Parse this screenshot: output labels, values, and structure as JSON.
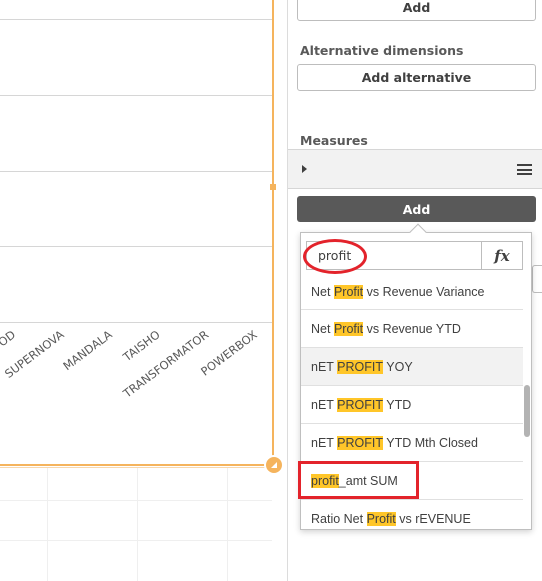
{
  "panel": {
    "add_dimension_label": "Add",
    "alternative_dimensions_title": "Alternative dimensions",
    "add_alternative_label": "Add alternative",
    "measures_title": "Measures",
    "add_measure_label": "Add"
  },
  "chart": {
    "x_axis_labels": [
      "OD",
      "SUPERNOVA",
      "MANDALA",
      "TAISHO",
      "TRANSFORMATOR",
      "POWERBOX"
    ]
  },
  "search": {
    "value": "profit",
    "fx_label": "fx"
  },
  "results": [
    {
      "pre": "Net ",
      "match": "Profit",
      "post": " vs Revenue Variance"
    },
    {
      "pre": "Net ",
      "match": "Profit",
      "post": " vs Revenue YTD"
    },
    {
      "pre": "nET ",
      "match": "PROFIT",
      "post": " YOY"
    },
    {
      "pre": "nET ",
      "match": "PROFIT",
      "post": " YTD"
    },
    {
      "pre": "nET ",
      "match": "PROFIT",
      "post": " YTD Mth Closed"
    },
    {
      "pre": "",
      "match": "profit",
      "post": "_amt SUM"
    },
    {
      "pre": "Ratio Net ",
      "match": "Profit",
      "post": " vs rEVENUE"
    }
  ],
  "colors": {
    "selection_orange": "#f5b45d",
    "highlight_yellow": "#ffc629",
    "annotation_red": "#e3232b",
    "dark_button": "#595959"
  }
}
